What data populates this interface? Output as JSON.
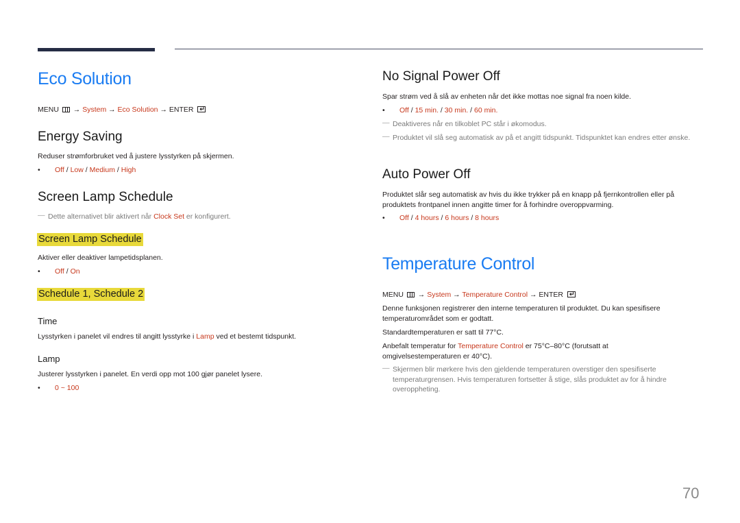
{
  "left": {
    "title": "Eco Solution",
    "menu_path": {
      "menu": "MENU",
      "arrow": "→",
      "step1": "System",
      "step2": "Eco Solution",
      "enter": "ENTER"
    },
    "energy_saving": {
      "heading": "Energy Saving",
      "desc": "Reduser strømforbruket ved å justere lysstyrken på skjermen.",
      "options": [
        "Off",
        "Low",
        "Medium",
        "High"
      ]
    },
    "screen_lamp_schedule": {
      "heading": "Screen Lamp Schedule",
      "note_before": "Dette alternativet blir aktivert når ",
      "note_link": "Clock Set",
      "note_after": " er konfigurert.",
      "sub_heading": "Screen Lamp Schedule",
      "sub_desc": "Aktiver eller deaktiver lampetidsplanen.",
      "sub_options": [
        "Off",
        "On"
      ],
      "schedule_heading": "Schedule 1, Schedule 2",
      "time_label": "Time",
      "time_desc_before": "Lysstyrken i panelet vil endres til angitt lysstyrke i ",
      "time_desc_link": "Lamp",
      "time_desc_after": " ved et bestemt tidspunkt.",
      "lamp_label": "Lamp",
      "lamp_desc": "Justerer lysstyrken i panelet. En verdi opp mot 100 gjør panelet lysere.",
      "lamp_range": "0 ~ 100"
    }
  },
  "right": {
    "no_signal": {
      "heading": "No Signal Power Off",
      "desc": "Spar strøm ved å slå av enheten når det ikke mottas noe signal fra noen kilde.",
      "options": [
        "Off",
        "15 min.",
        "30 min.",
        "60 min."
      ],
      "note1": "Deaktiveres når en tilkoblet PC står i økomodus.",
      "note2": "Produktet vil slå seg automatisk av på et angitt tidspunkt. Tidspunktet kan endres etter ønske."
    },
    "auto_power_off": {
      "heading": "Auto Power Off",
      "desc": "Produktet slår seg automatisk av hvis du ikke trykker på en knapp på fjernkontrollen eller på produktets frontpanel innen angitte timer for å forhindre overoppvarming.",
      "options": [
        "Off",
        "4 hours",
        "6 hours",
        "8 hours"
      ]
    },
    "temperature_control": {
      "title": "Temperature Control",
      "menu_path": {
        "menu": "MENU",
        "arrow": "→",
        "step1": "System",
        "step2": "Temperature Control",
        "enter": "ENTER"
      },
      "desc1": "Denne funksjonen registrerer den interne temperaturen til produktet. Du kan spesifisere temperaturområdet som er godtatt.",
      "desc2": "Standardtemperaturen er satt til 77°C.",
      "desc3_before": "Anbefalt temperatur for ",
      "desc3_link": "Temperature Control",
      "desc3_after": " er 75°C–80°C (forutsatt at omgivelsestemperaturen er 40°C).",
      "note": "Skjermen blir mørkere hvis den gjeldende temperaturen overstiger den spesifiserte temperaturgrensen. Hvis temperaturen fortsetter å stige, slås produktet av for å hindre overoppheting."
    }
  },
  "glyphs": {
    "bullet": "•",
    "dash": "―",
    "slash": " / "
  },
  "page_number": "70"
}
